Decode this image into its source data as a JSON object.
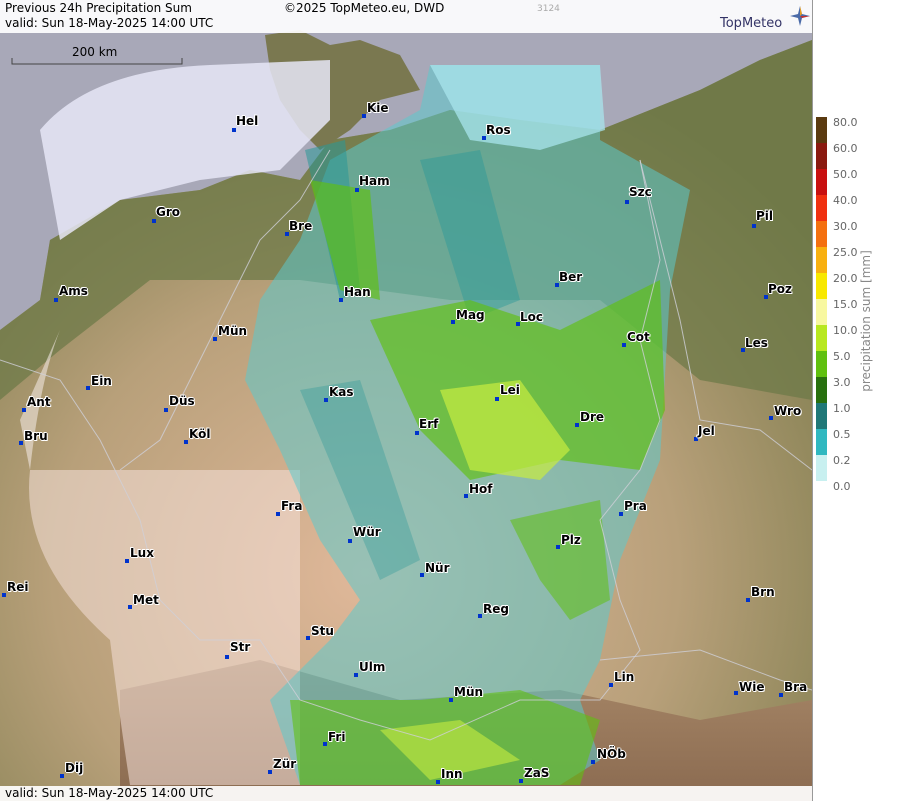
{
  "header": {
    "title": "Previous 24h Precipitation Sum",
    "copyright": "©2025 TopMeteo.eu, DWD",
    "id_code": "3124",
    "valid": "valid:  Sun  18-May-2025 14:00 UTC",
    "logo_text": "TopMeteo"
  },
  "footer": {
    "valid": "valid:  Sun  18-May-2025 14:00 UTC"
  },
  "scale": {
    "label": "200 km"
  },
  "cities": [
    {
      "name": "Kie"
    },
    {
      "name": "Hel"
    },
    {
      "name": "Ros"
    },
    {
      "name": "Ham"
    },
    {
      "name": "Szc"
    },
    {
      "name": "Gro"
    },
    {
      "name": "Bre"
    },
    {
      "name": "Pil"
    },
    {
      "name": "Ber"
    },
    {
      "name": "Ams"
    },
    {
      "name": "Han"
    },
    {
      "name": "Poz"
    },
    {
      "name": "Mag"
    },
    {
      "name": "Loc"
    },
    {
      "name": "Mün"
    },
    {
      "name": "Cot"
    },
    {
      "name": "Les"
    },
    {
      "name": "Ein"
    },
    {
      "name": "Kas"
    },
    {
      "name": "Lei"
    },
    {
      "name": "Ant"
    },
    {
      "name": "Düs"
    },
    {
      "name": "Dre"
    },
    {
      "name": "Wro"
    },
    {
      "name": "Bru"
    },
    {
      "name": "Köl"
    },
    {
      "name": "Erf"
    },
    {
      "name": "Jel"
    },
    {
      "name": "Hof"
    },
    {
      "name": "Fra"
    },
    {
      "name": "Pra"
    },
    {
      "name": "Wür"
    },
    {
      "name": "Plz"
    },
    {
      "name": "Lux"
    },
    {
      "name": "Nür"
    },
    {
      "name": "Rei"
    },
    {
      "name": "Met"
    },
    {
      "name": "Reg"
    },
    {
      "name": "Brn"
    },
    {
      "name": "Stu"
    },
    {
      "name": "Str"
    },
    {
      "name": "Ulm"
    },
    {
      "name": "Lin"
    },
    {
      "name": "Mün"
    },
    {
      "name": "Wie"
    },
    {
      "name": "Bra"
    },
    {
      "name": "Fri"
    },
    {
      "name": "NÖb"
    },
    {
      "name": "Dij"
    },
    {
      "name": "Zür"
    },
    {
      "name": "Inn"
    },
    {
      "name": "ZaS"
    }
  ],
  "legend": {
    "title": "precipitation sum [mm]",
    "levels": [
      {
        "label": "80.0",
        "color": "#5a3a10"
      },
      {
        "label": "60.0",
        "color": "#8a1a10"
      },
      {
        "label": "50.0",
        "color": "#c81010"
      },
      {
        "label": "40.0",
        "color": "#f03010"
      },
      {
        "label": "30.0",
        "color": "#f47010"
      },
      {
        "label": "25.0",
        "color": "#f8b010"
      },
      {
        "label": "20.0",
        "color": "#f8e800"
      },
      {
        "label": "15.0",
        "color": "#f8f8a0"
      },
      {
        "label": "10.0",
        "color": "#b8e820"
      },
      {
        "label": "5.0",
        "color": "#60c010"
      },
      {
        "label": "3.0",
        "color": "#287010"
      },
      {
        "label": "1.0",
        "color": "#207878"
      },
      {
        "label": "0.5",
        "color": "#30b8c0"
      },
      {
        "label": "0.2",
        "color": "#c8f0f0"
      },
      {
        "label": "0.0",
        "color": "#ffffff"
      }
    ]
  }
}
